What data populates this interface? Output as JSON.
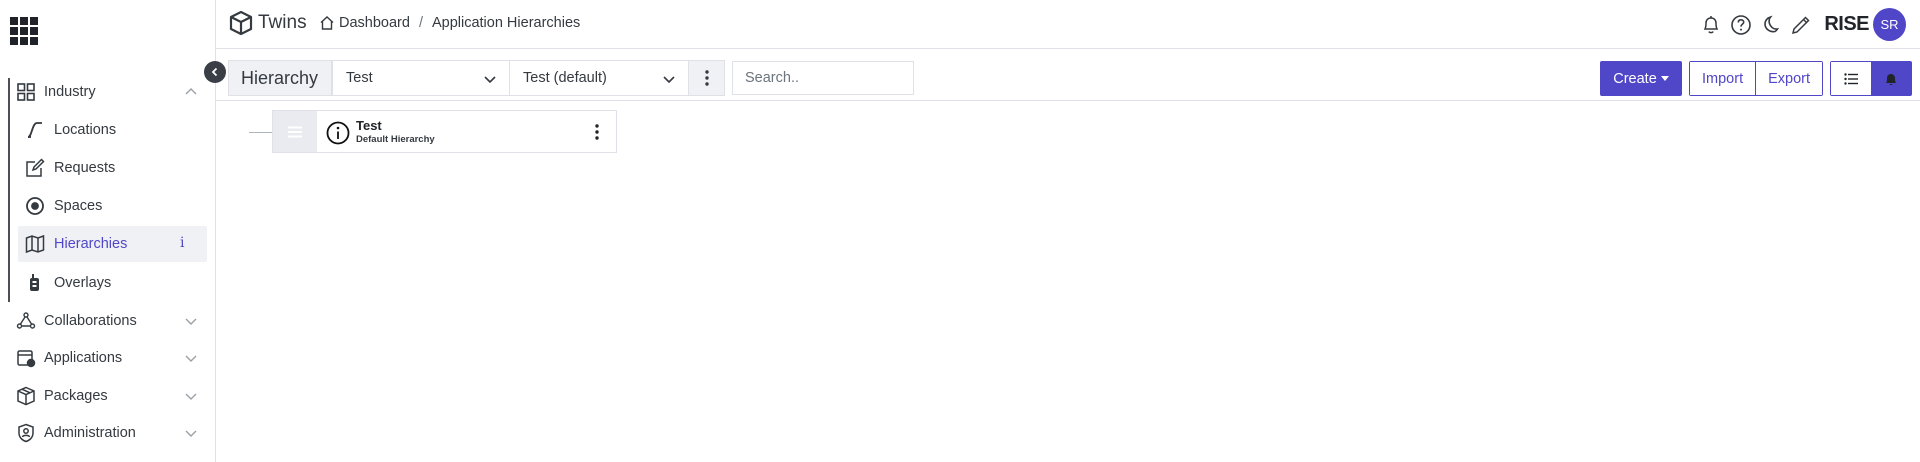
{
  "app": {
    "brand_name": "Twins",
    "org_name": "RISE",
    "user_initials": "SR"
  },
  "breadcrumb": {
    "items": [
      "Dashboard",
      "Application Hierarchies"
    ],
    "separator": "/"
  },
  "sidebar": {
    "groups": [
      {
        "label": "Industry",
        "icon": "industry-icon",
        "expanded": true
      },
      {
        "label": "Collaborations",
        "icon": "collaborations-icon",
        "expanded": false
      },
      {
        "label": "Applications",
        "icon": "applications-icon",
        "expanded": false
      },
      {
        "label": "Packages",
        "icon": "packages-icon",
        "expanded": false
      },
      {
        "label": "Administration",
        "icon": "administration-icon",
        "expanded": false
      }
    ],
    "industry_items": [
      {
        "label": "Locations",
        "icon": "locations-icon",
        "active": false
      },
      {
        "label": "Requests",
        "icon": "requests-icon",
        "active": false
      },
      {
        "label": "Spaces",
        "icon": "spaces-icon",
        "active": false
      },
      {
        "label": "Hierarchies",
        "icon": "map-icon",
        "active": true,
        "badge": "i"
      },
      {
        "label": "Overlays",
        "icon": "overlays-icon",
        "active": false
      }
    ]
  },
  "toolbar": {
    "title": "Hierarchy",
    "hierarchy_select": "Test",
    "version_select": "Test (default)",
    "search_placeholder": "Search..",
    "create_label": "Create",
    "import_label": "Import",
    "export_label": "Export"
  },
  "tree": {
    "nodes": [
      {
        "title": "Test",
        "subtitle": "Default Hierarchy"
      }
    ]
  },
  "colors": {
    "accent": "#5046c8",
    "border": "#dfe1e6",
    "text": "#343a40"
  }
}
